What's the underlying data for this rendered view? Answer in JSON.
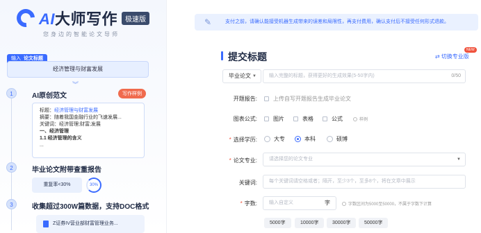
{
  "app": {
    "logo_ai": "AI",
    "logo_name": "大师写作",
    "badge": "极速版",
    "slogan": "您身边的智能论文导师"
  },
  "left": {
    "input_tab_prefix": "输入",
    "input_tab_label": "论文标题",
    "input_value": "经济管理与财富发展",
    "steps": [
      {
        "num": "1",
        "title": "AI原创范文",
        "tag": "写作样例"
      },
      {
        "num": "2",
        "title": "毕业论文附带查重报告"
      },
      {
        "num": "3",
        "title": "收集超过300W篇数据，支持DOC格式"
      }
    ],
    "sample": {
      "title_label": "标题：",
      "title_value": "经济管理与财富发展",
      "abstract": "摘要：随着我国金融行业的飞速发展...",
      "keywords": "关键词：经济管理;财富;发展",
      "h1": "一、经济管理",
      "h2": "1.1 经济管理的含义",
      "ellipsis": "..."
    },
    "check_rate": "重复率<30%",
    "check_ring": "30%",
    "doc_item": "Z证券IV营业部财富管理业务..."
  },
  "notice": "支付之前，请确认能接受机器生成带来的误差和局限性，再支付费用，确认支付后不接受任何形式退款。",
  "form": {
    "section_title": "提交标题",
    "switch_label": "切换专业版",
    "new_badge": "NEW",
    "paper_type": "毕业论文",
    "title_placeholder": "输入完整的标题，获得更好的生成效果(5-50字内)",
    "title_count": "0/50",
    "proposal_label": "开题报告:",
    "proposal_option": "上传自写开题报告生成毕业论文",
    "chart_label": "图表公式:",
    "chart_options": [
      "图片",
      "表格",
      "公式"
    ],
    "chart_example": "样例",
    "education_label": "选择学历:",
    "education_options": [
      "大专",
      "本科",
      "硕博"
    ],
    "education_selected": "本科",
    "major_label": "论文专业:",
    "major_placeholder": "请选择您的论文专业",
    "keywords_label": "关键词:",
    "keywords_placeholder": "每个关键词请空格或者；隔开，至少3个，至多8个，将在文章中展示",
    "words_label": "字数:",
    "words_placeholder": "输入自定义",
    "words_unit": "字",
    "words_hint": "字数区间为5000至50000，不属于字数下计算",
    "word_chips": [
      "5000字",
      "10000字",
      "30000字",
      "50000字"
    ]
  },
  "colors": {
    "accent": "#3a6bff",
    "danger": "#f0533d",
    "tag": "#f06b4e"
  }
}
